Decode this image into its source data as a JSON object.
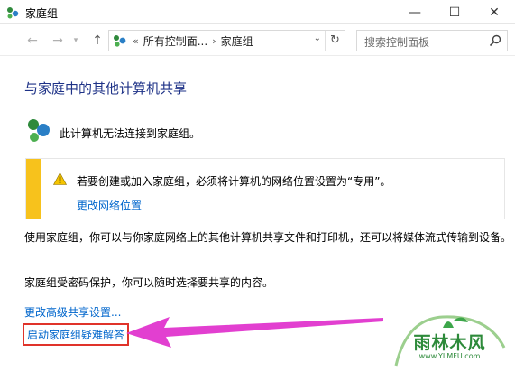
{
  "window": {
    "title": "家庭组",
    "minimize": "—",
    "maximize": "☐",
    "close": "✕"
  },
  "nav": {
    "back": "←",
    "forward": "→",
    "dropdown": "▾",
    "up": "↑",
    "breadcrumb": [
      "所有控制面...",
      "家庭组"
    ],
    "breadcrumb_sep": "«",
    "breadcrumb_arrow": "›",
    "address_dropdown": "⌄",
    "refresh": "↻",
    "search_placeholder": "搜索控制面板"
  },
  "main": {
    "page_title": "与家庭中的其他计算机共享",
    "status": "此计算机无法连接到家庭组。",
    "warning": {
      "text": "若要创建或加入家庭组，必须将计算机的网络位置设置为“专用”。",
      "link": "更改网络位置"
    },
    "description": "使用家庭组，你可以与你家庭网络上的其他计算机共享文件和打印机，还可以将媒体流式传输到设备。",
    "password_note": "家庭组受密码保护，你可以随时选择要共享的内容。",
    "advanced_link": "更改高级共享设置...",
    "troubleshoot_link": "启动家庭组疑难解答"
  },
  "watermark": {
    "text": "雨林木风",
    "url": "www.YLMFU.com"
  },
  "colors": {
    "title_blue": "#1e3287",
    "link_blue": "#0066cc",
    "warning_yellow": "#f7c21c",
    "highlight_red": "#e0332a",
    "arrow_magenta": "#e23fd0"
  }
}
